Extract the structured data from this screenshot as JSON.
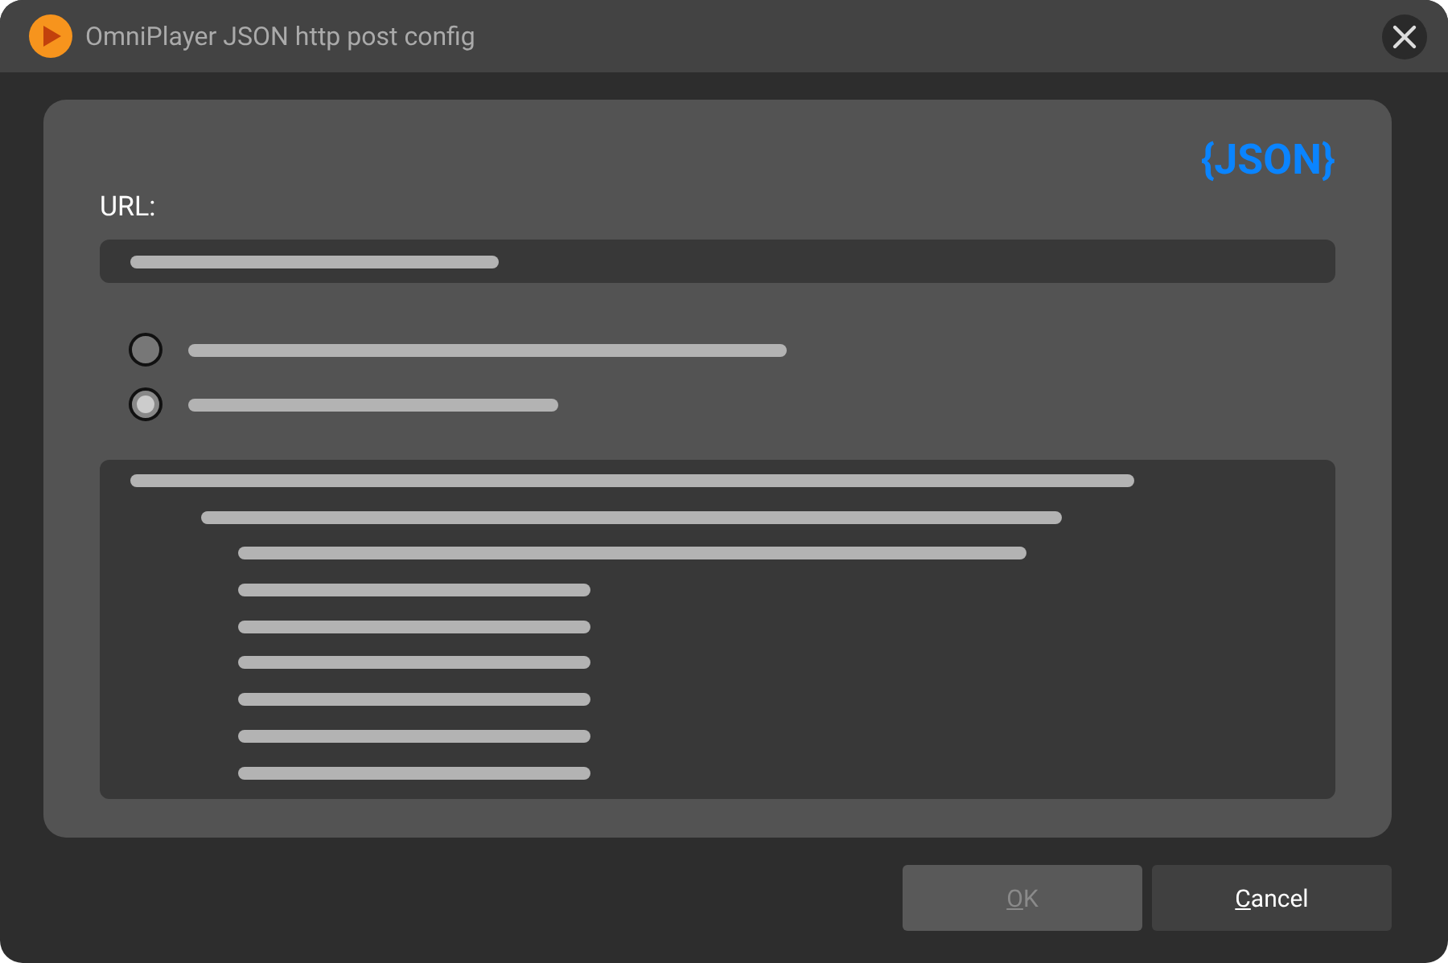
{
  "window": {
    "title": "OmniPlayer JSON http post config"
  },
  "card": {
    "logo": "{JSON}",
    "url_label": "URL:"
  },
  "options": [
    {
      "selected": false
    },
    {
      "selected": true
    }
  ],
  "buttons": [
    {
      "label": "OK",
      "disabled": true
    },
    {
      "label": "Cancel",
      "disabled": false
    }
  ]
}
